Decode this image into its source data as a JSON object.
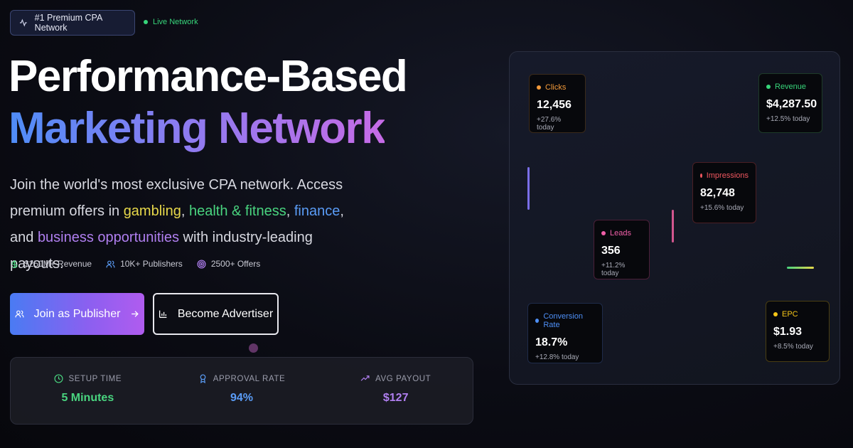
{
  "badge": {
    "label": "#1 Premium CPA Network",
    "icon": "activity-icon"
  },
  "live": {
    "label": "Live Network",
    "color": "#37d57a"
  },
  "hero": {
    "title_line1": "Performance-Based",
    "title_line2": "Marketing Network",
    "desc_part1": "Join the world's most exclusive CPA network. Access premium offers in ",
    "gambling": "gambling",
    "comma1": ", ",
    "health": "health & fitness",
    "comma2": ", ",
    "finance": "finance",
    "and": ", and ",
    "business": "business opportunities",
    "desc_end": " with industry-leading payouts."
  },
  "inline_stats": [
    {
      "label": "$250M+ Revenue",
      "icon": "dollar-icon"
    },
    {
      "label": "10K+ Publishers",
      "icon": "users-icon"
    },
    {
      "label": "2500+ Offers",
      "icon": "target-icon"
    }
  ],
  "buttons": {
    "publisher": "Join as Publisher",
    "advertiser": "Become Advertiser"
  },
  "metrics": [
    {
      "label": "SETUP TIME",
      "value": "5 Minutes",
      "icon": "clock-icon",
      "color": "#49d47f"
    },
    {
      "label": "APPROVAL RATE",
      "value": "94%",
      "icon": "award-icon",
      "color": "#5a9cf6"
    },
    {
      "label": "AVG PAYOUT",
      "value": "$127",
      "icon": "trending-up-icon",
      "color": "#b07ff0"
    }
  ],
  "cards": {
    "clicks": {
      "title": "Clicks",
      "value": "12,456",
      "change": "+27.6% today",
      "color": "#f39a3a"
    },
    "revenue": {
      "title": "Revenue",
      "value": "$4,287.50",
      "change": "+12.5% today",
      "color": "#37d57a"
    },
    "impressions": {
      "title": "Impressions",
      "value": "82,748",
      "change": "+15.6% today",
      "color": "#f0575f"
    },
    "leads": {
      "title": "Leads",
      "value": "356",
      "change": "+11.2% today",
      "color": "#f05fa8"
    },
    "conversion": {
      "title": "Conversion Rate",
      "value": "18.7%",
      "change": "+12.8% today",
      "color": "#4e8ff6"
    },
    "epc": {
      "title": "EPC",
      "value": "$1.93",
      "change": "+8.5% today",
      "color": "#f5c518"
    }
  }
}
